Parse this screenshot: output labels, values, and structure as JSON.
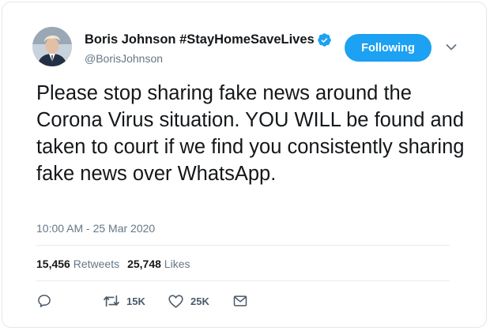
{
  "author": {
    "display_name": "Boris Johnson #StayHomeSaveLives",
    "handle": "@BorisJohnson"
  },
  "follow_button": {
    "label": "Following"
  },
  "tweet": {
    "text": "Please stop sharing fake news around the Corona Virus situation. YOU WILL be found and taken to court if we find you consistently sharing fake news over WhatsApp.",
    "timestamp": "10:00 AM - 25 Mar 2020"
  },
  "stats": {
    "retweets_count": "15,456",
    "retweets_label": "Retweets",
    "likes_count": "25,748",
    "likes_label": "Likes"
  },
  "actions": {
    "retweet_count": "15K",
    "like_count": "25K"
  },
  "icons": {
    "verified": "verified-badge-icon",
    "chevron": "chevron-down-icon",
    "reply": "reply-icon",
    "retweet": "retweet-icon",
    "like": "heart-icon",
    "share": "share-icon"
  },
  "colors": {
    "accent": "#1da1f2",
    "text": "#14171a",
    "secondary": "#657786",
    "border": "#e1e8ed"
  }
}
